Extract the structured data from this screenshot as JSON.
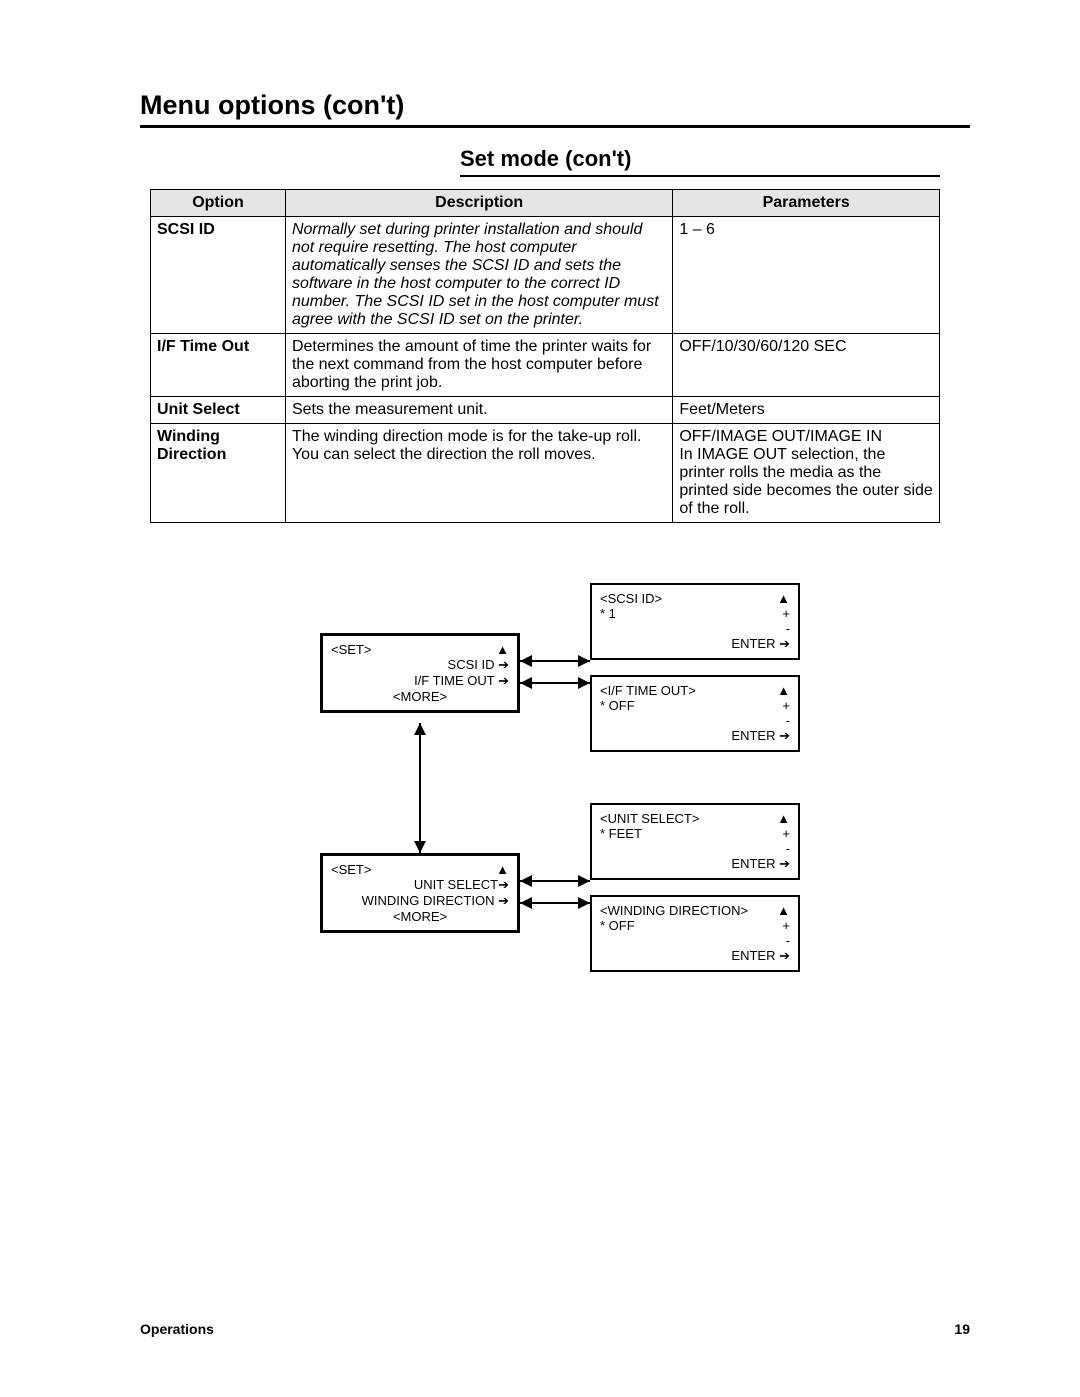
{
  "headings": {
    "main": "Menu options (con't)",
    "sub": "Set mode (con't)"
  },
  "table": {
    "headers": {
      "option": "Option",
      "description": "Description",
      "parameters": "Parameters"
    },
    "rows": [
      {
        "option": "SCSI ID",
        "description": "Normally set during printer installation and should not require resetting.  The host computer automatically senses the SCSI ID and sets the software in the host computer to the correct ID number.  The SCSI ID set in the host computer must agree with the SCSI ID set on the printer.",
        "description_italic": true,
        "parameters": "1 – 6"
      },
      {
        "option": "I/F Time Out",
        "description": "Determines the amount of time the printer waits for the next command from the host computer before aborting the print job.",
        "parameters": "OFF/10/30/60/120 SEC"
      },
      {
        "option": "Unit Select",
        "description": "Sets the measurement unit.",
        "parameters": "Feet/Meters"
      },
      {
        "option": "Winding Direction",
        "description": "The winding direction mode is for the take-up roll.  You can select the direction the roll moves.",
        "parameters": "OFF/IMAGE OUT/IMAGE IN\nIn IMAGE OUT selection, the printer rolls the media as the printed side becomes the outer side of the roll."
      }
    ]
  },
  "diagram": {
    "set1": {
      "title": "<SET>",
      "line1": "SCSI ID ➔",
      "line2": "I/F TIME OUT ➔",
      "more": "<MORE>",
      "up": "▲"
    },
    "set2": {
      "title": "<SET>",
      "line1": "UNIT SELECT➔",
      "line2": "WINDING DIRECTION ➔",
      "more": "<MORE>",
      "up": "▲"
    },
    "scsi": {
      "title": "<SCSI ID>",
      "value": "*  1",
      "plus": "+",
      "minus": "-",
      "enter": "ENTER ➔",
      "up": "▲"
    },
    "ifto": {
      "title": "<I/F TIME OUT>",
      "value": "*  OFF",
      "plus": "+",
      "minus": "-",
      "enter": "ENTER ➔",
      "up": "▲"
    },
    "unit": {
      "title": "<UNIT SELECT>",
      "value": "*  FEET",
      "plus": "+",
      "minus": "-",
      "enter": "ENTER ➔",
      "up": "▲"
    },
    "wind": {
      "title": "<WINDING DIRECTION>",
      "value": "*  OFF",
      "plus": "+",
      "minus": "-",
      "enter": "ENTER ➔",
      "up": "▲"
    }
  },
  "footer": {
    "left": "Operations",
    "right": "19"
  }
}
